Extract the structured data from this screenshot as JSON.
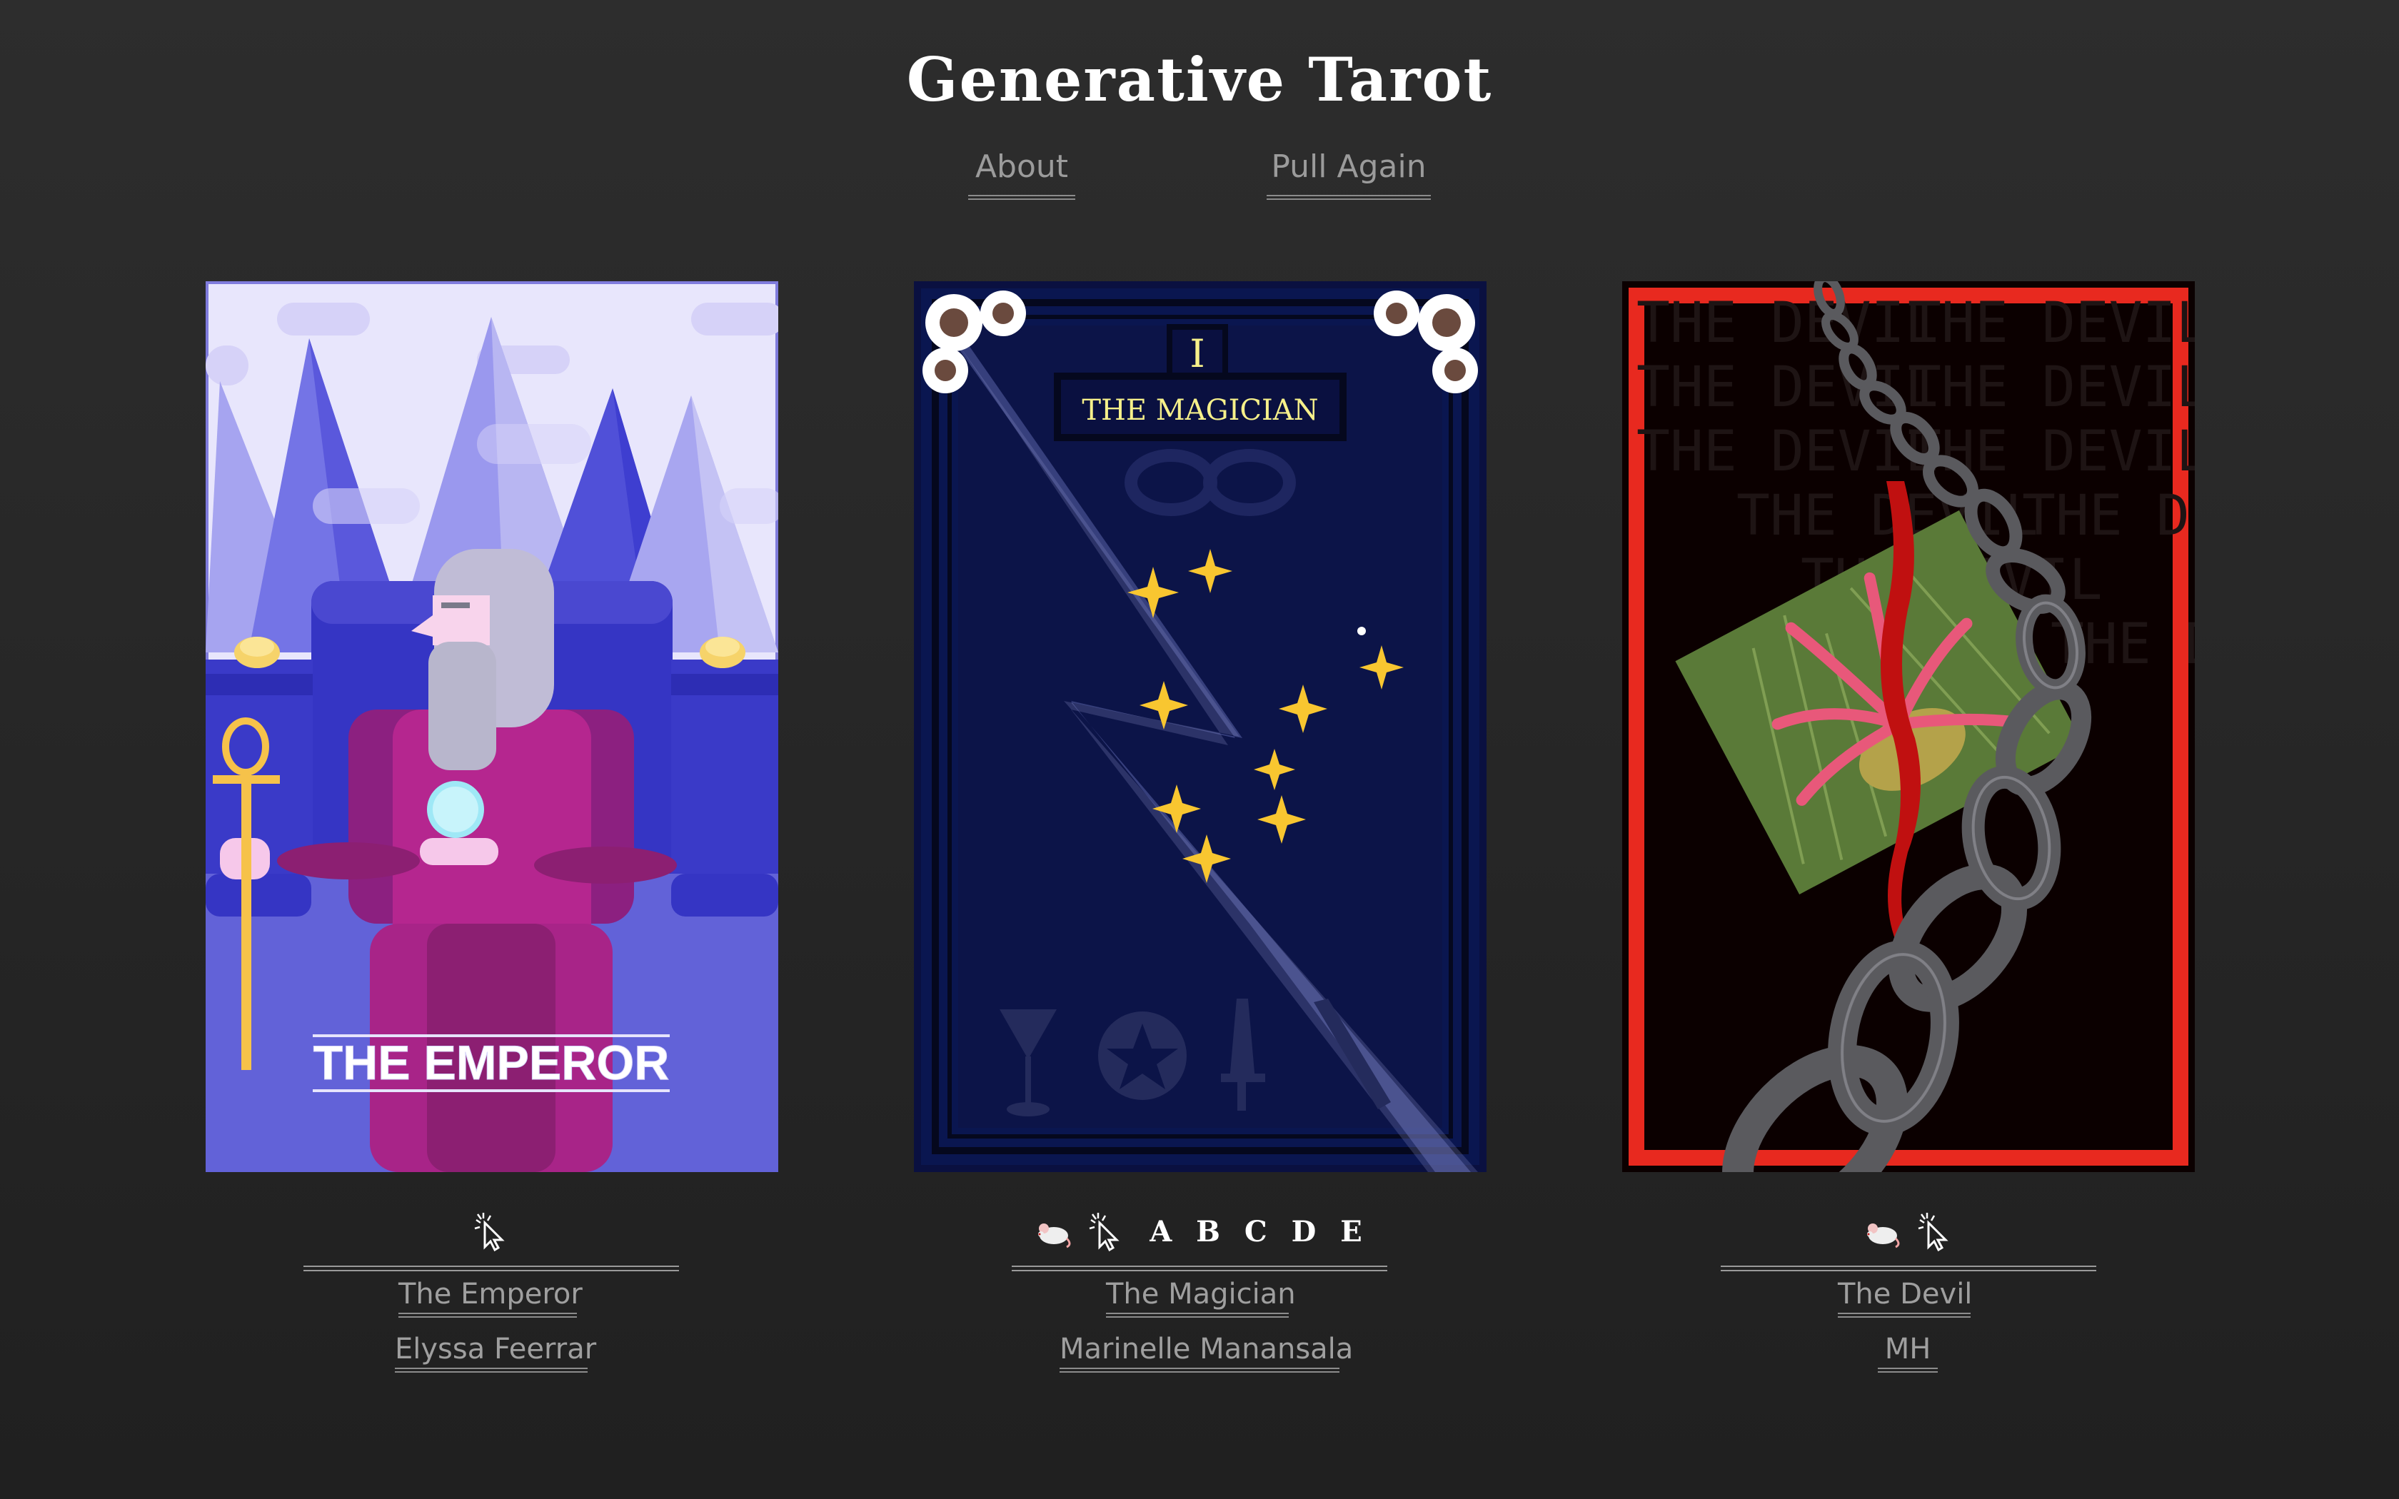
{
  "site": {
    "title": "Generative Tarot"
  },
  "nav": {
    "about_label": "About",
    "pull_again_label": "Pull Again"
  },
  "cards": [
    {
      "title_text": "THE EMPEROR",
      "card_name": "The Emperor",
      "artist": "Elyssa Feerrar",
      "controls": [
        "cursor-click-icon"
      ],
      "letters": ""
    },
    {
      "numeral": "I",
      "title_text": "THE MAGICIAN",
      "card_name": "The Magician",
      "artist": "Marinelle Manansala",
      "controls": [
        "mouse-icon",
        "cursor-click-icon"
      ],
      "letters": "A B C D E"
    },
    {
      "watermark_text": "THE DEVIL",
      "card_name": "The Devil",
      "artist": "MH",
      "controls": [
        "mouse-icon",
        "cursor-click-icon"
      ],
      "letters": ""
    }
  ],
  "colors": {
    "background": "#262626",
    "emperor_sky": "#e8e6fc",
    "emperor_robe": "#b5268f",
    "magician_bg": "#0a1040",
    "magician_text": "#f6f08a",
    "devil_frame": "#e8291f",
    "devil_bg": "#0b0000"
  }
}
